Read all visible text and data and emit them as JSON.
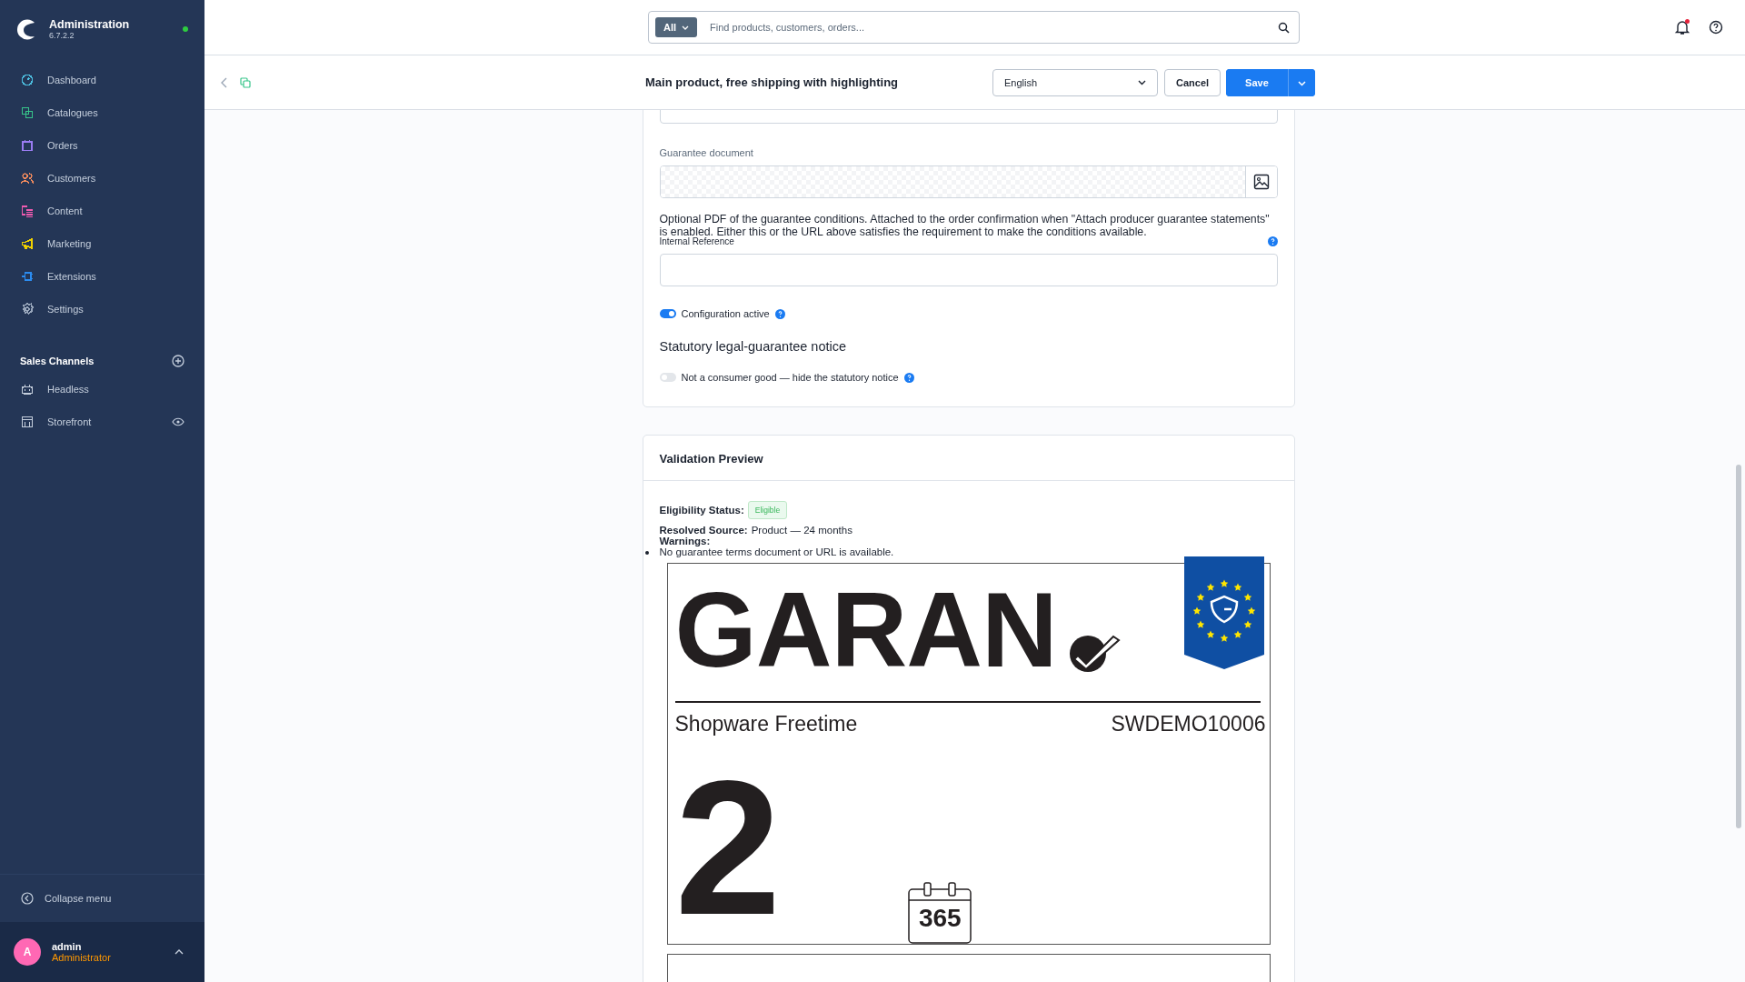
{
  "sidebar": {
    "brand": {
      "title": "Administration",
      "version": "6.7.2.2",
      "online": true
    },
    "nav": [
      {
        "label": "Dashboard",
        "kind": "dashboard",
        "color": "#4dbfe0"
      },
      {
        "label": "Catalogues",
        "kind": "catalogues",
        "color": "#37c58a"
      },
      {
        "label": "Orders",
        "kind": "orders",
        "color": "#9a7cf2"
      },
      {
        "label": "Customers",
        "kind": "customers",
        "color": "#f08a5d"
      },
      {
        "label": "Content",
        "kind": "content",
        "color": "#ef5bb0"
      },
      {
        "label": "Marketing",
        "kind": "marketing",
        "color": "#f0d000"
      },
      {
        "label": "Extensions",
        "kind": "extensions",
        "color": "#2b8cf0"
      },
      {
        "label": "Settings",
        "kind": "settings",
        "color": "#9aa8bc"
      }
    ],
    "sales_channels": {
      "title": "Sales Channels",
      "items": [
        {
          "label": "Headless",
          "kind": "headless",
          "visible_toggle": false
        },
        {
          "label": "Storefront",
          "kind": "storefront",
          "visible_toggle": true
        }
      ]
    },
    "collapse": "Collapse menu",
    "user": {
      "initial": "A",
      "name": "admin",
      "role": "Administrator"
    }
  },
  "topbar": {
    "scope": "All",
    "placeholder": "Find products, customers, orders...",
    "unread": true
  },
  "toolbar": {
    "title": "Main product, free shipping with highlighting",
    "language": "English",
    "cancel": "Cancel",
    "save": "Save"
  },
  "form": {
    "document_label": "Guarantee document",
    "document_help": "Optional PDF of the guarantee conditions. Attached to the order confirmation when \"Attach producer guarantee statements\" is enabled. Either this or the URL above satisfies the requirement to make the conditions available.",
    "reference_label": "Internal Reference",
    "active": {
      "label": "Configuration active",
      "on": true
    },
    "notice_heading": "Statutory legal-guarantee notice",
    "consumer": {
      "label": "Not a consumer good — hide the statutory notice",
      "on": false
    }
  },
  "preview": {
    "title": "Validation Preview",
    "status_label": "Eligibility Status:",
    "status": "Eligible",
    "source_label": "Resolved Source:",
    "source": "Product — 24 months",
    "warnings_label": "Warnings:",
    "warnings": [
      "No guarantee terms document or URL is available."
    ],
    "label": {
      "title": "GARAN",
      "product": "Shopware Freetime",
      "number": "SWDEMO10006",
      "years": "2",
      "days": "365"
    }
  }
}
